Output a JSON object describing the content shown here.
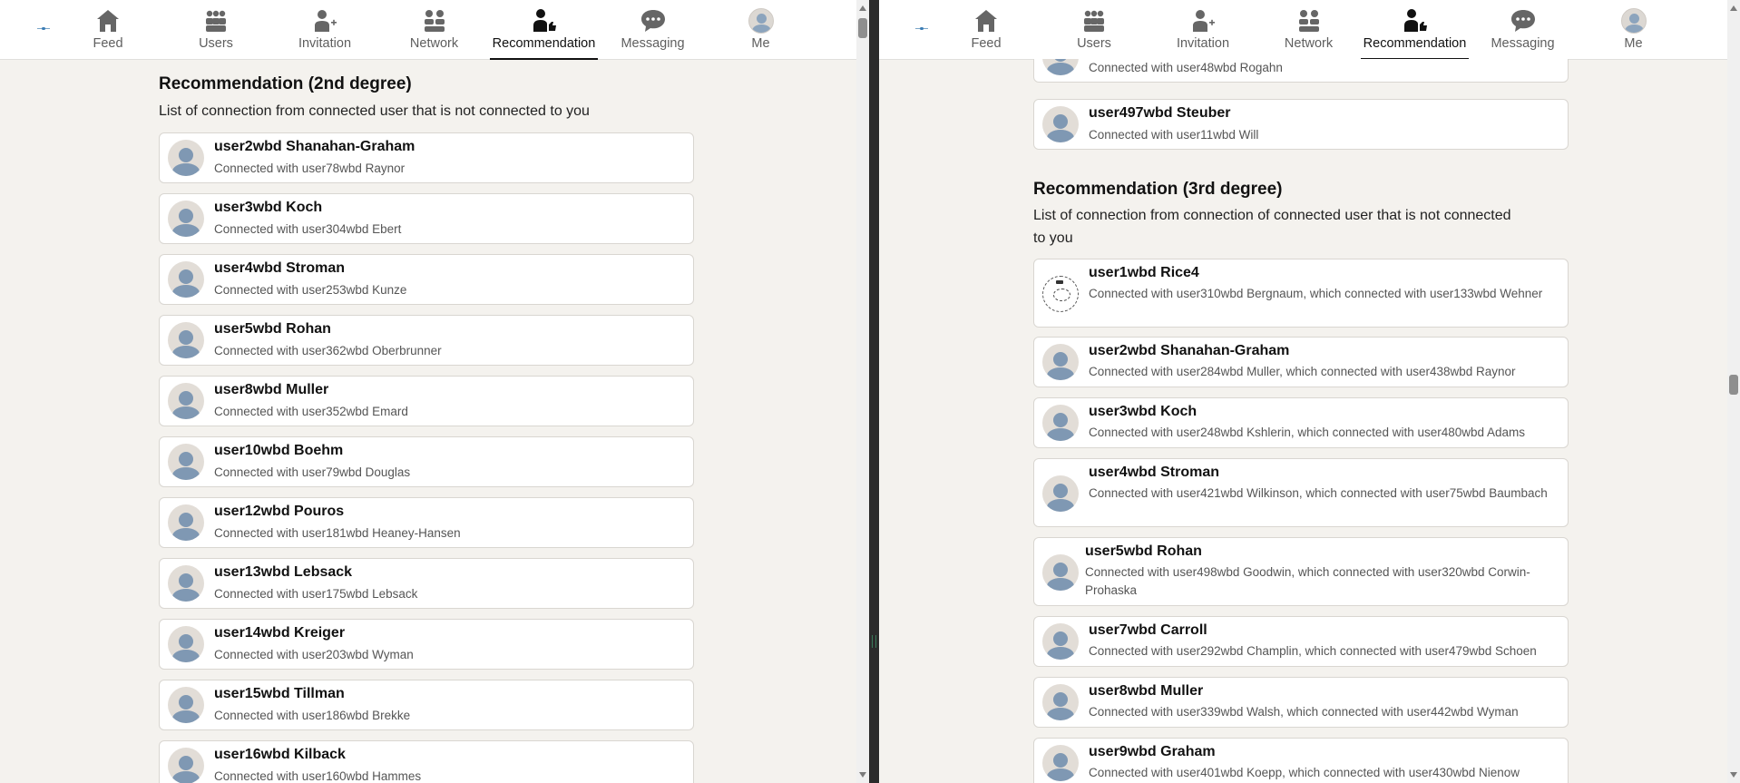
{
  "nav": {
    "items": [
      {
        "label": "Feed",
        "icon": "home-icon"
      },
      {
        "label": "Users",
        "icon": "users-icon"
      },
      {
        "label": "Invitation",
        "icon": "person-add-icon"
      },
      {
        "label": "Network",
        "icon": "network-icon"
      },
      {
        "label": "Recommendation",
        "icon": "recommend-icon",
        "active": true
      },
      {
        "label": "Messaging",
        "icon": "chat-icon"
      },
      {
        "label": "Me",
        "icon": "avatar-icon"
      }
    ]
  },
  "left": {
    "title": "Recommendation (2nd degree)",
    "description": "List of connection from connected user that is not connected to you",
    "cards": [
      {
        "name": "user2wbd Shanahan-Graham",
        "sub": "Connected with user78wbd Raynor"
      },
      {
        "name": "user3wbd Koch",
        "sub": "Connected with user304wbd Ebert"
      },
      {
        "name": "user4wbd Stroman",
        "sub": "Connected with user253wbd Kunze"
      },
      {
        "name": "user5wbd Rohan",
        "sub": "Connected with user362wbd Oberbrunner"
      },
      {
        "name": "user8wbd Muller",
        "sub": "Connected with user352wbd Emard"
      },
      {
        "name": "user10wbd Boehm",
        "sub": "Connected with user79wbd Douglas"
      },
      {
        "name": "user12wbd Pouros",
        "sub": "Connected with user181wbd Heaney-Hansen"
      },
      {
        "name": "user13wbd Lebsack",
        "sub": "Connected with user175wbd Lebsack"
      },
      {
        "name": "user14wbd Kreiger",
        "sub": "Connected with user203wbd Wyman"
      },
      {
        "name": "user15wbd Tillman",
        "sub": "Connected with user186wbd Brekke"
      },
      {
        "name": "user16wbd Kilback",
        "sub": "Connected with user160wbd Hammes"
      }
    ]
  },
  "right": {
    "top_cards": [
      {
        "name": "",
        "sub": "Connected with user48wbd Rogahn"
      },
      {
        "name": "user497wbd Steuber",
        "sub": "Connected with user11wbd Will"
      }
    ],
    "title": "Recommendation (3rd degree)",
    "description_line1": "List of connection from connection of connected user that is not connected",
    "description_line2": "to you",
    "cards": [
      {
        "name": "user1wbd Rice4",
        "sub": "Connected with user310wbd Bergnaum, which connected with user133wbd Wehner",
        "sketch": true
      },
      {
        "name": "user2wbd Shanahan-Graham",
        "sub": "Connected with user284wbd Muller, which connected with user438wbd Raynor"
      },
      {
        "name": "user3wbd Koch",
        "sub": "Connected with user248wbd Kshlerin, which connected with user480wbd Adams"
      },
      {
        "name": "user4wbd Stroman",
        "sub": "Connected with user421wbd Wilkinson, which connected with user75wbd Baumbach"
      },
      {
        "name": "user5wbd Rohan",
        "sub": "Connected with user498wbd Goodwin, which connected with user320wbd Corwin-Prohaska"
      },
      {
        "name": "user7wbd Carroll",
        "sub": "Connected with user292wbd Champlin, which connected with user479wbd Schoen"
      },
      {
        "name": "user8wbd Muller",
        "sub": "Connected with user339wbd Walsh, which connected with user442wbd Wyman"
      },
      {
        "name": "user9wbd Graham",
        "sub": "Connected with user401wbd Koepp, which connected with user430wbd Nienow"
      }
    ]
  }
}
